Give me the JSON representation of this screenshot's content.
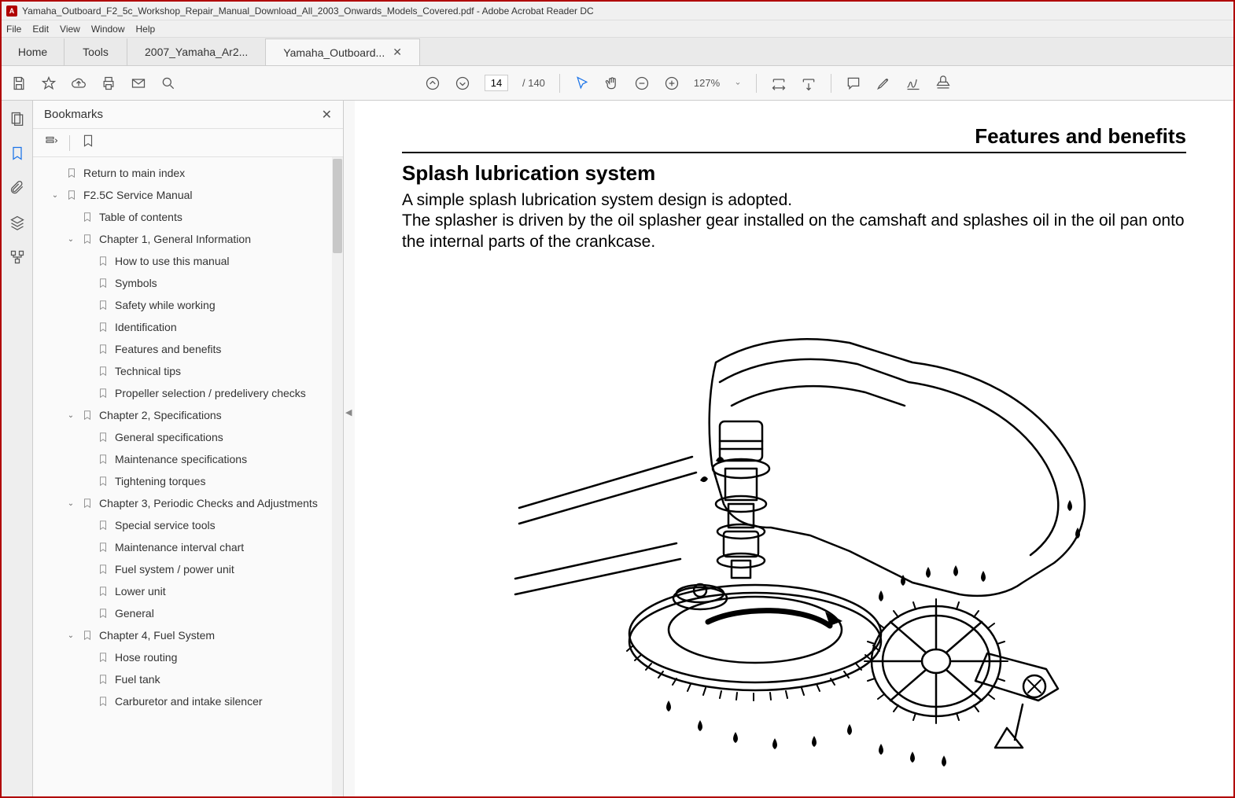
{
  "window": {
    "title": "Yamaha_Outboard_F2_5c_Workshop_Repair_Manual_Download_All_2003_Onwards_Models_Covered.pdf - Adobe Acrobat Reader DC",
    "app_icon_text": "A"
  },
  "menu": {
    "items": [
      "File",
      "Edit",
      "View",
      "Window",
      "Help"
    ]
  },
  "tabs": {
    "home": "Home",
    "tools": "Tools",
    "docs": [
      {
        "label": "2007_Yamaha_Ar2...",
        "active": false
      },
      {
        "label": "Yamaha_Outboard...",
        "active": true
      }
    ]
  },
  "toolbar": {
    "page_current": "14",
    "page_total": "/ 140",
    "zoom": "127%"
  },
  "sidepanel": {
    "title": "Bookmarks"
  },
  "bookmarks": [
    {
      "level": 0,
      "caret": "",
      "label": "Return to main index"
    },
    {
      "level": 0,
      "caret": "v",
      "label": "F2.5C Service Manual"
    },
    {
      "level": 1,
      "caret": "",
      "label": "Table of contents"
    },
    {
      "level": 1,
      "caret": "v",
      "label": "Chapter 1, General Information"
    },
    {
      "level": 2,
      "caret": "",
      "label": "How to use this manual"
    },
    {
      "level": 2,
      "caret": "",
      "label": "Symbols"
    },
    {
      "level": 2,
      "caret": "",
      "label": "Safety while working"
    },
    {
      "level": 2,
      "caret": "",
      "label": "Identification"
    },
    {
      "level": 2,
      "caret": "",
      "label": "Features and benefits"
    },
    {
      "level": 2,
      "caret": "",
      "label": "Technical tips"
    },
    {
      "level": 2,
      "caret": "",
      "label": "Propeller selection / predelivery checks"
    },
    {
      "level": 1,
      "caret": "v",
      "label": "Chapter 2, Specifications"
    },
    {
      "level": 2,
      "caret": "",
      "label": "General specifications"
    },
    {
      "level": 2,
      "caret": "",
      "label": "Maintenance specifications"
    },
    {
      "level": 2,
      "caret": "",
      "label": "Tightening torques"
    },
    {
      "level": 1,
      "caret": "v",
      "label": "Chapter 3, Periodic Checks and Adjustments"
    },
    {
      "level": 2,
      "caret": "",
      "label": "Special service tools"
    },
    {
      "level": 2,
      "caret": "",
      "label": "Maintenance interval chart"
    },
    {
      "level": 2,
      "caret": "",
      "label": "Fuel system / power unit"
    },
    {
      "level": 2,
      "caret": "",
      "label": "Lower unit"
    },
    {
      "level": 2,
      "caret": "",
      "label": "General"
    },
    {
      "level": 1,
      "caret": "v",
      "label": "Chapter 4, Fuel System"
    },
    {
      "level": 2,
      "caret": "",
      "label": "Hose routing"
    },
    {
      "level": 2,
      "caret": "",
      "label": "Fuel tank"
    },
    {
      "level": 2,
      "caret": "",
      "label": "Carburetor and intake silencer"
    }
  ],
  "document": {
    "header": "Features and benefits",
    "heading": "Splash lubrication system",
    "para1": "A simple splash lubrication system design is adopted.",
    "para2": "The splasher is driven by the oil splasher gear installed on the camshaft and splashes oil in the oil pan onto the internal parts of the crankcase."
  }
}
